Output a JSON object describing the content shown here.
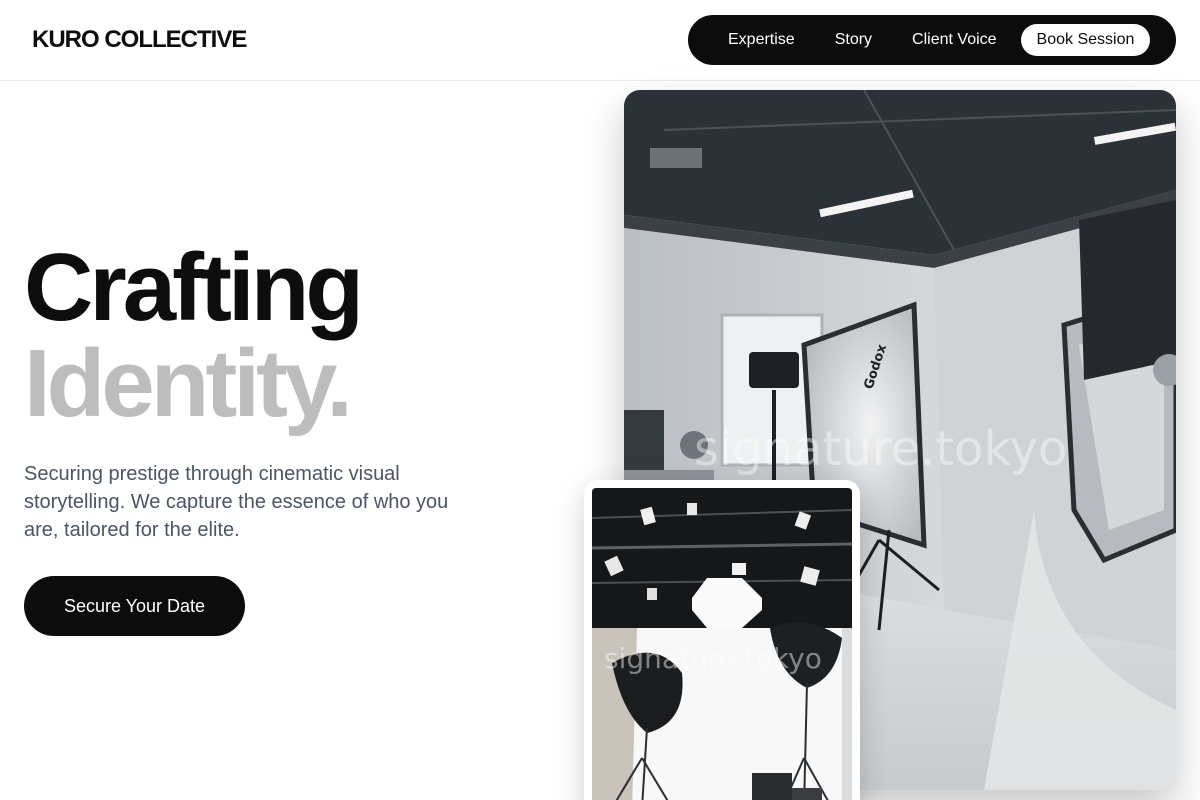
{
  "brand": {
    "logo_text": "KURO COLLECTIVE"
  },
  "nav": {
    "links": [
      "Expertise",
      "Story",
      "Client Voice"
    ],
    "cta_label": "Book Session"
  },
  "hero": {
    "headline_line1": "Crafting",
    "headline_line2": "Identity.",
    "subtext": "Securing prestige through cinematic visual storytelling. We capture the essence of who you are, tailored for the elite.",
    "cta_label": "Secure Your Date"
  },
  "images": {
    "main_watermark": "signature.tokyo",
    "small_watermark": "signature.tokyo",
    "softbox_brand": "Godox"
  },
  "colors": {
    "primary": "#0c0c0c",
    "headline_muted": "#bdbdbd",
    "body_text": "#4b5563",
    "background": "#ffffff"
  }
}
